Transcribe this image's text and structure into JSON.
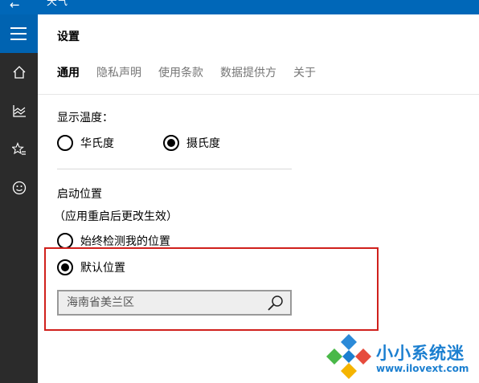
{
  "window": {
    "back_glyph": "←",
    "title": "天气"
  },
  "sidebar": {
    "menu_icon": "hamburger-icon",
    "items": [
      {
        "icon": "home-icon"
      },
      {
        "icon": "chart-icon"
      },
      {
        "icon": "star-list-icon"
      },
      {
        "icon": "smiley-icon"
      }
    ]
  },
  "page": {
    "title": "设置"
  },
  "tabs": [
    {
      "label": "通用",
      "active": true
    },
    {
      "label": "隐私声明"
    },
    {
      "label": "使用条款"
    },
    {
      "label": "数据提供方"
    },
    {
      "label": "关于"
    }
  ],
  "temperature": {
    "label": "显示温度：",
    "options": [
      {
        "label": "华氏度",
        "selected": false
      },
      {
        "label": "摄氏度",
        "selected": true
      }
    ]
  },
  "location": {
    "label": "启动位置",
    "note": "（应用重启后更改生效）",
    "options": [
      {
        "label": "始终检测我的位置",
        "selected": false
      },
      {
        "label": "默认位置",
        "selected": true
      }
    ],
    "search": {
      "value": "",
      "placeholder": "海南省美兰区",
      "icon": "search-icon"
    }
  },
  "highlight_color": "#d0201c",
  "accent_color": "#0067b8",
  "watermark": {
    "brand": "小小系统迷",
    "url": "www.ilovext.com"
  }
}
